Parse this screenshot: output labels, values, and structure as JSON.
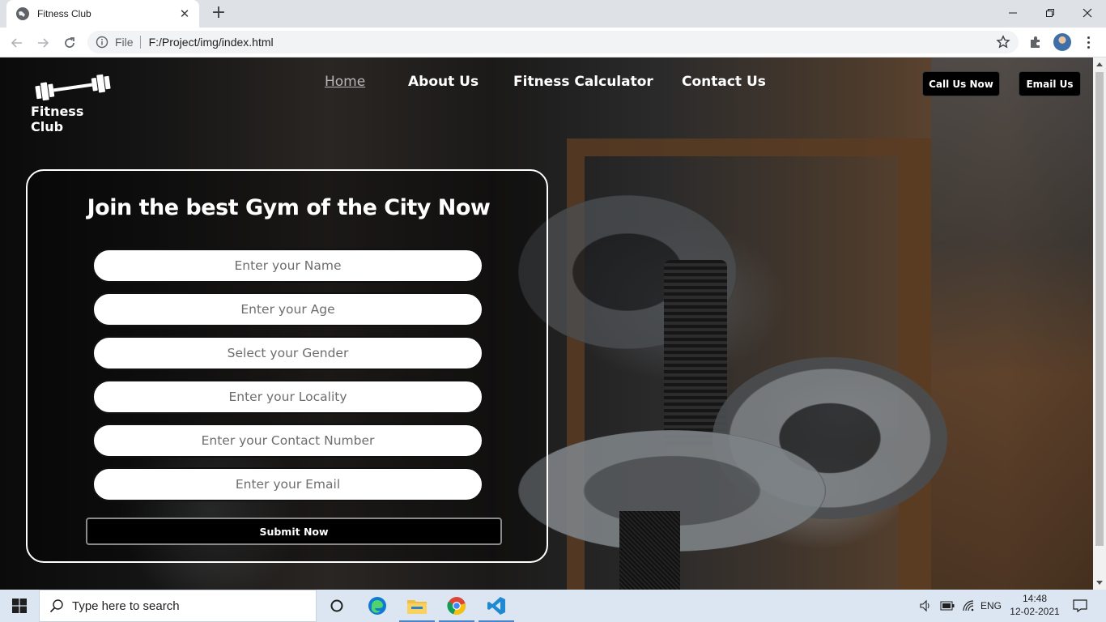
{
  "browser": {
    "tab_title": "Fitness Club",
    "tab_close": "✕",
    "new_tab": "+",
    "omnibox_scheme": "File",
    "omnibox_url": "F:/Project/img/index.html"
  },
  "site": {
    "brand_name": "Fitness Club",
    "nav": [
      {
        "label": "Home",
        "active": true
      },
      {
        "label": "About Us"
      },
      {
        "label": "Fitness Calculator"
      },
      {
        "label": "Contact Us"
      }
    ],
    "header_buttons": {
      "call": "Call Us Now",
      "email": "Email Us"
    },
    "form": {
      "title": "Join the best Gym of the City Now",
      "fields": [
        "Enter your Name",
        "Enter your Age",
        "Select your Gender",
        "Enter your Locality",
        "Enter your Contact Number",
        "Enter your Email"
      ],
      "submit": "Submit Now"
    }
  },
  "taskbar": {
    "search_placeholder": "Type here to search",
    "language": "ENG",
    "time": "14:48",
    "date": "12-02-2021"
  },
  "colors": {
    "accent": "#000000",
    "card_border": "#ffffff",
    "taskbar": "#dce6f2"
  }
}
